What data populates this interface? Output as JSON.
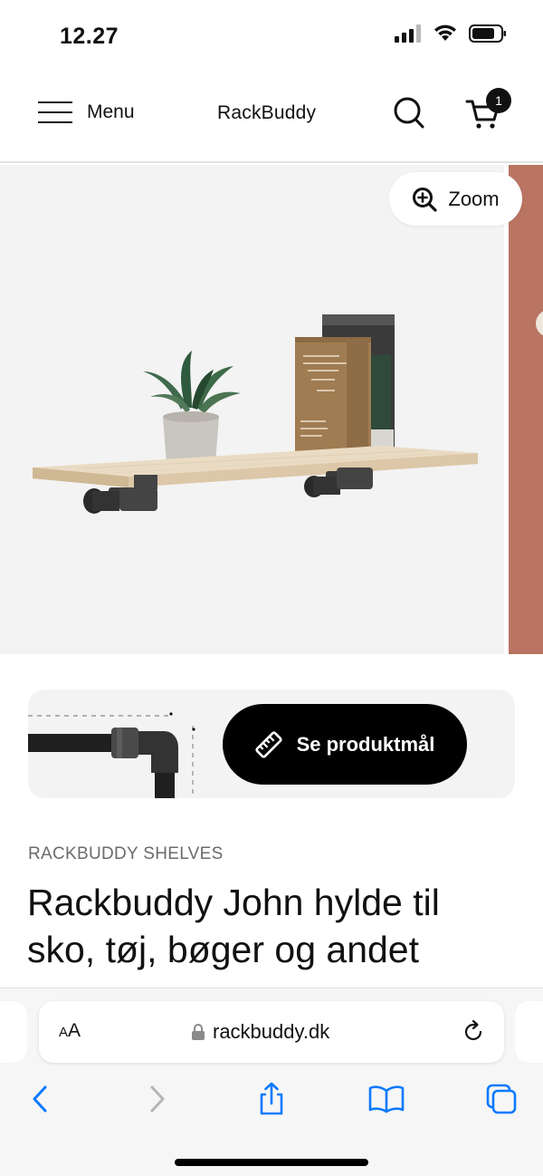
{
  "status_bar": {
    "time": "12.27"
  },
  "header": {
    "menu_label": "Menu",
    "brand": "RackBuddy",
    "cart_count": "1"
  },
  "gallery": {
    "zoom_label": "Zoom"
  },
  "measure": {
    "button_label": "Se produktmål"
  },
  "product": {
    "category": "RACKBUDDY SHELVES",
    "title": "Rackbuddy John hylde til sko, tøj, bøger og andet"
  },
  "browser": {
    "text_size_small": "A",
    "text_size_big": "A",
    "url": "rackbuddy.dk"
  },
  "colors": {
    "accent": "#000000",
    "gallery_bg": "#f3f3f3",
    "next_image": "#b97462",
    "safari_blue": "#0a7aff"
  }
}
